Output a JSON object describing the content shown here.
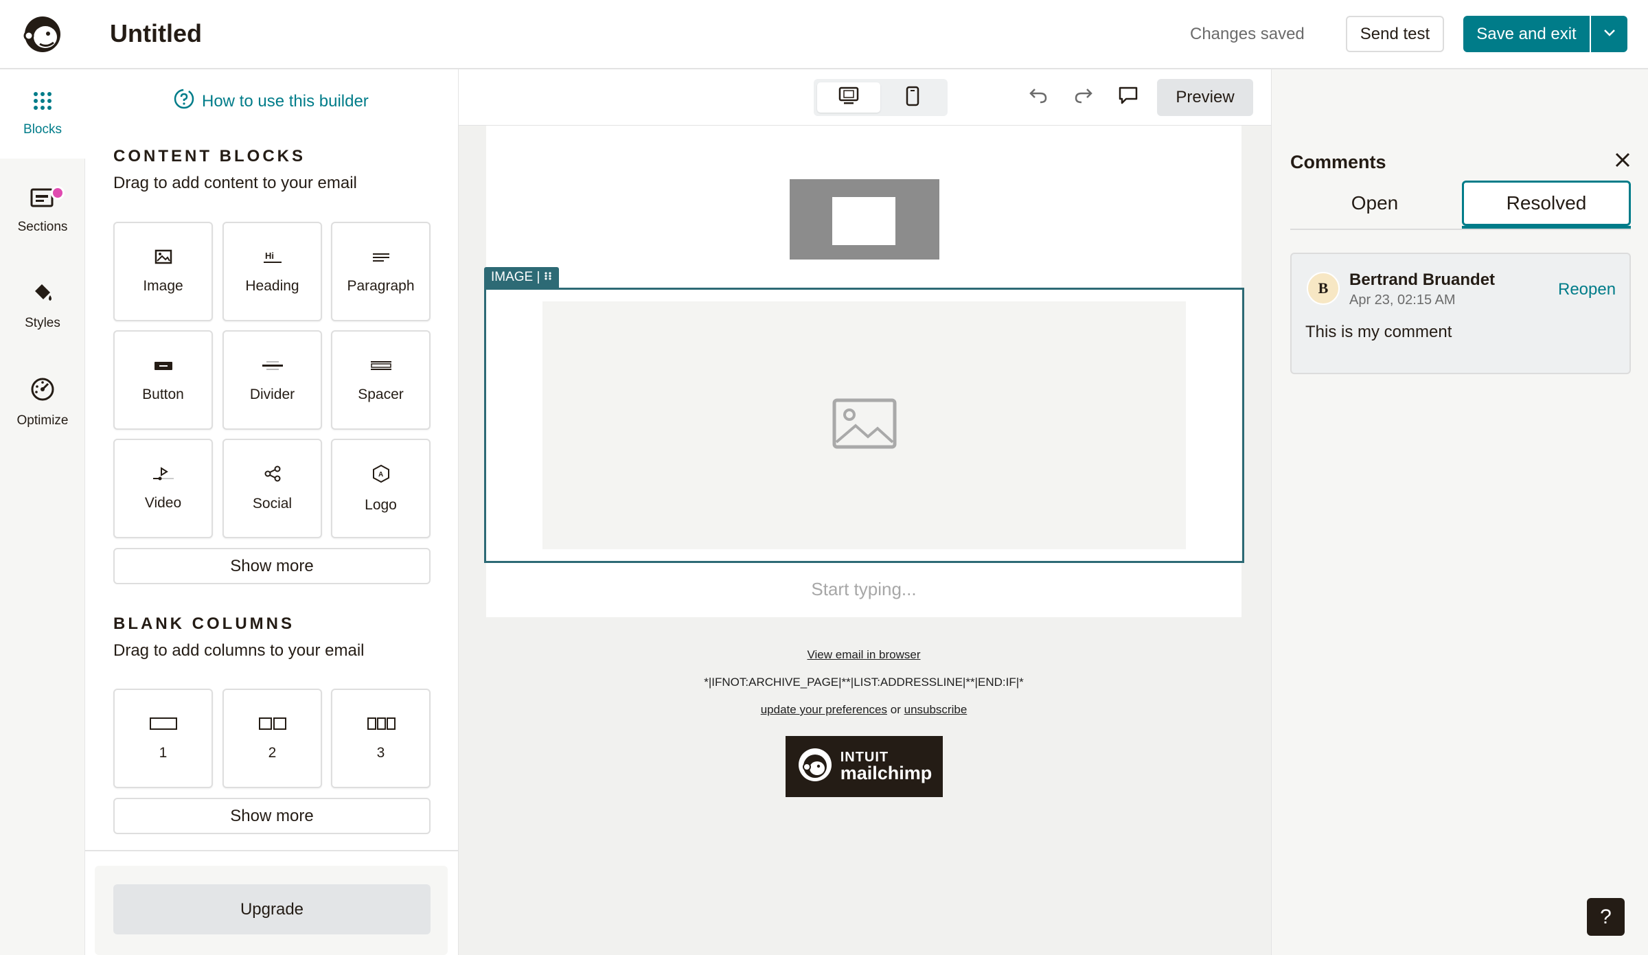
{
  "header": {
    "title": "Untitled",
    "status": "Changes saved",
    "send_test": "Send test",
    "save_exit": "Save and exit"
  },
  "rail": {
    "items": [
      {
        "label": "Blocks",
        "icon": "grid-dots-icon"
      },
      {
        "label": "Sections",
        "icon": "sections-icon"
      },
      {
        "label": "Styles",
        "icon": "paint-bucket-icon"
      },
      {
        "label": "Optimize",
        "icon": "gauge-icon"
      }
    ]
  },
  "panel": {
    "howto": "How to use this builder",
    "content_title": "CONTENT BLOCKS",
    "content_sub": "Drag to add content to your email",
    "blocks": [
      "Image",
      "Heading",
      "Paragraph",
      "Button",
      "Divider",
      "Spacer",
      "Video",
      "Social",
      "Logo"
    ],
    "show_more_1": "Show more",
    "columns_title": "BLANK COLUMNS",
    "columns_sub": "Drag to add columns to your email",
    "columns": [
      "1",
      "2",
      "3"
    ],
    "show_more_2": "Show more",
    "upgrade": "Upgrade"
  },
  "canvas": {
    "preview": "Preview",
    "image_tag": "IMAGE |",
    "typing_placeholder": "Start typing...",
    "footer": {
      "view_browser": "View email in browser",
      "merge_tags": "*|IFNOT:ARCHIVE_PAGE|**|LIST:ADDRESSLINE|**|END:IF|*",
      "prefs": "update your preferences",
      "or": "or",
      "unsubscribe": "unsubscribe",
      "badge_line1": "INTUIT",
      "badge_line2": "mailchimp"
    }
  },
  "comments": {
    "title": "Comments",
    "tabs": [
      "Open",
      "Resolved"
    ],
    "active_tab": "Resolved",
    "items": [
      {
        "initial": "B",
        "author": "Bertrand Bruandet",
        "date": "Apr 23, 02:15 AM",
        "action": "Reopen",
        "body": "This is my comment"
      }
    ]
  },
  "help": "?",
  "colors": {
    "accent": "#007c89",
    "selection": "#2d6a75",
    "badge": "#e04bb0",
    "dark": "#241c15"
  }
}
